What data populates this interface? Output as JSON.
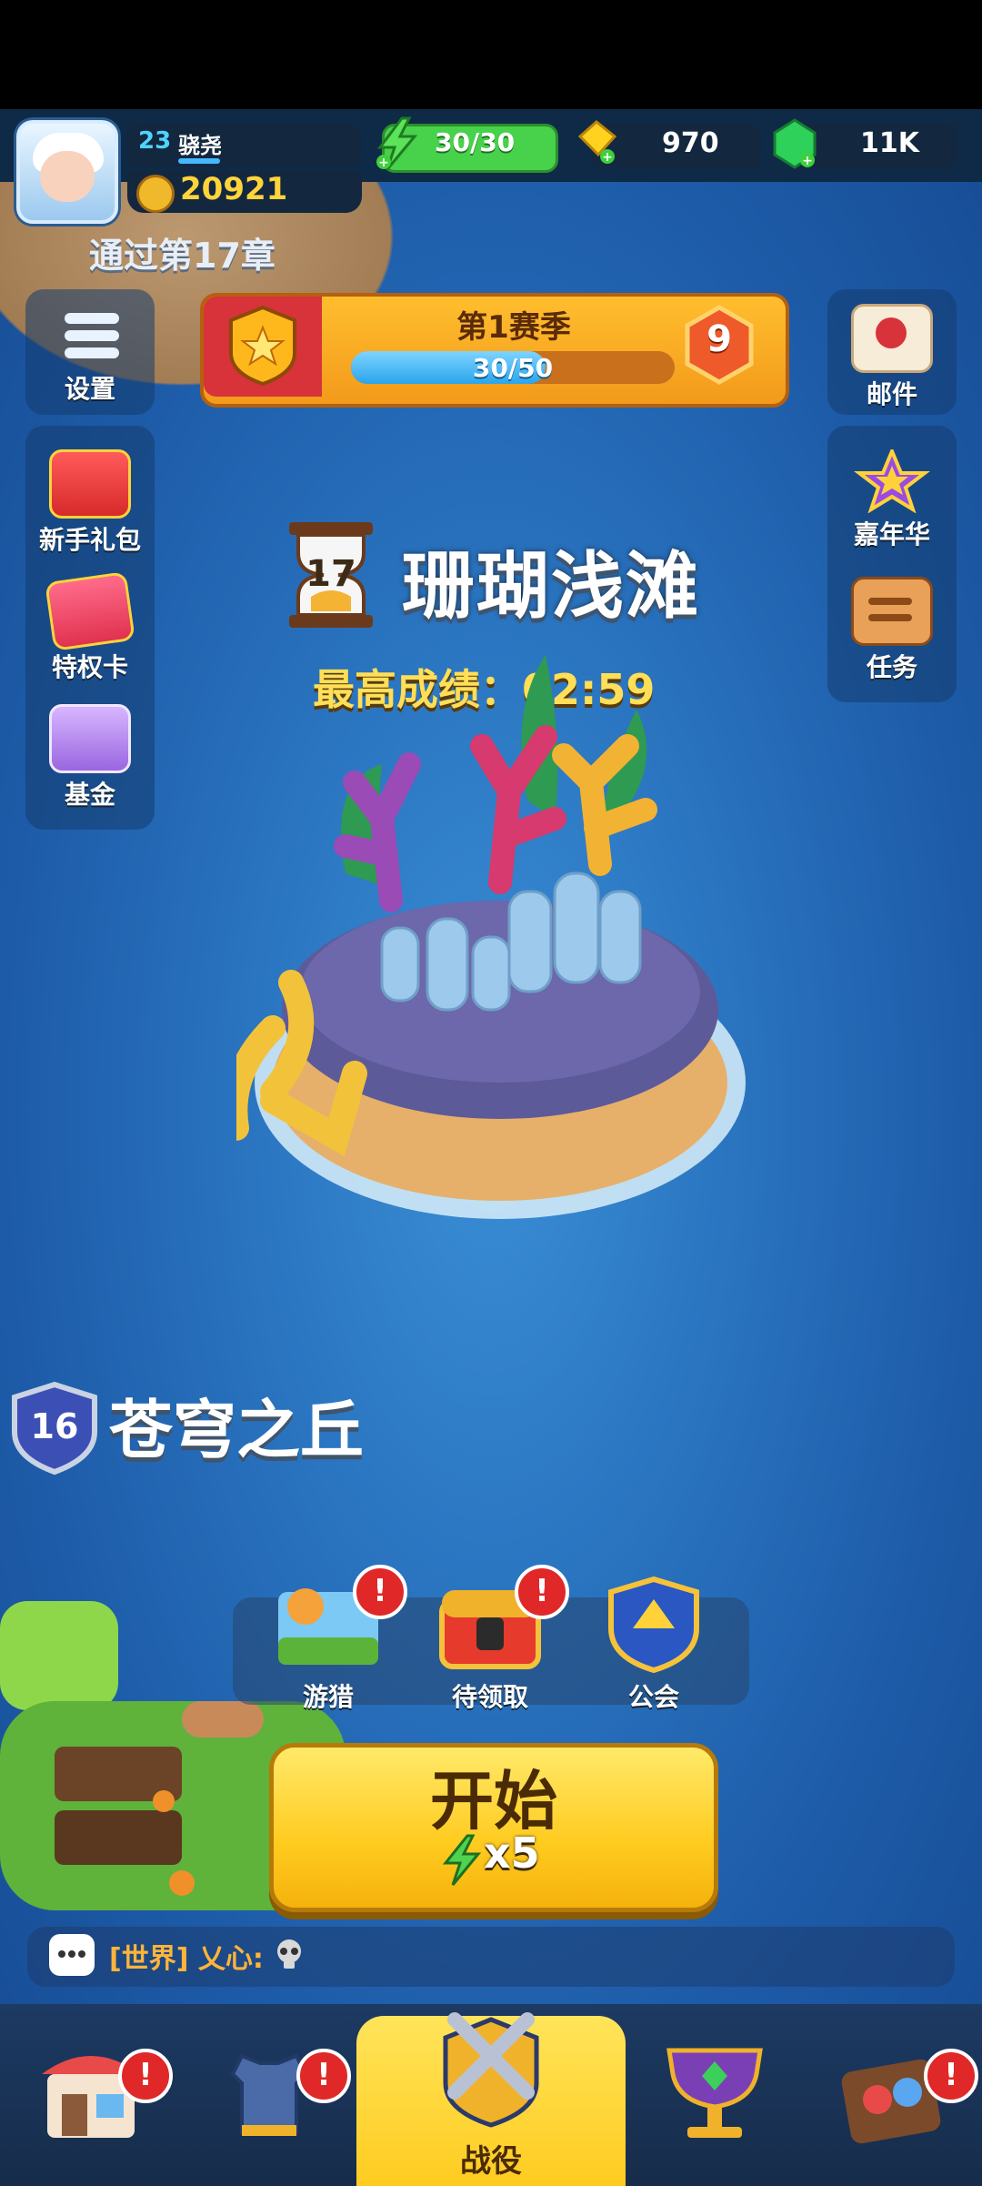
{
  "player": {
    "level": "23",
    "name": "骁尧",
    "trophies": "20921"
  },
  "currency": {
    "energy": "30/30",
    "gold": "970",
    "gems": "11K"
  },
  "chapter_text": "通过第17章",
  "season": {
    "title": "第1赛季",
    "progress_text": "30/50",
    "progress_fraction": 0.6,
    "level": "9"
  },
  "left_menu": {
    "settings": "设置",
    "starter_pack": "新手礼包",
    "privilege_card": "特权卡",
    "fund": "基金"
  },
  "right_menu": {
    "mail": "邮件",
    "carnival": "嘉年华",
    "tasks": "任务"
  },
  "stage": {
    "number": "17",
    "name": "珊瑚浅滩",
    "best_label": "最高成绩：02:59"
  },
  "next_stage": {
    "number": "16",
    "name": "苍穹之丘"
  },
  "quick_actions": {
    "hunt": "游猎",
    "pending": "待领取",
    "guild": "公会",
    "alert_mark": "!"
  },
  "start": {
    "label": "开始",
    "cost": "x5"
  },
  "chat": {
    "text": "[世界] 乂心:"
  },
  "nav": {
    "active_label": "战役",
    "alert_mark": "!"
  },
  "colors": {
    "ocean": "#2a74c0",
    "start_yellow": "#ffcb1f",
    "energy_green": "#48d14a",
    "alert_red": "#e02828"
  }
}
